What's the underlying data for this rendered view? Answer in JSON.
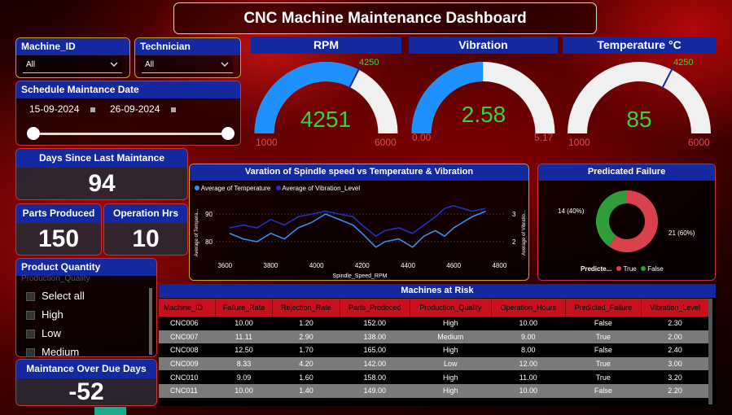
{
  "title": "CNC Machine Maintenance Dashboard",
  "colors": {
    "header_blue": "#1428a0",
    "accent_red": "#c8101e",
    "gauge_blue": "#1e90ff",
    "value_green": "#3ad23a"
  },
  "filters": {
    "machine_label": "Machine_ID",
    "machine_value": "All",
    "technician_label": "Technician",
    "technician_value": "All",
    "date_label": "Schedule Maintance Date",
    "date_from": "15-09-2024",
    "date_to": "26-09-2024"
  },
  "kpis": {
    "days_label": "Days Since Last Maintance",
    "days_value": "94",
    "parts_label": "Parts Produced",
    "parts_value": "150",
    "hours_label": "Operation Hrs",
    "hours_value": "10",
    "overdue_label": "Maintance Over Due Days",
    "overdue_value": "-52"
  },
  "product_quantity": {
    "label": "Product Quantity",
    "field_hint": "Production_Quality",
    "options": [
      "Select all",
      "High",
      "Low",
      "Medium"
    ]
  },
  "gauges": [
    {
      "title": "RPM",
      "value": "4251",
      "min": "1000",
      "max": "6000",
      "target": "4250",
      "fraction": 0.65,
      "target_fraction": 0.65
    },
    {
      "title": "Vibration",
      "value": "2.58",
      "min": "0.00",
      "max": "5.17",
      "target": "",
      "fraction": 0.499,
      "target_fraction": null
    },
    {
      "title": "Temperature °C",
      "value": "85",
      "min": "1000",
      "max": "6000",
      "target": "4250",
      "fraction": 0.0,
      "target_fraction": 0.65
    }
  ],
  "line_chart": {
    "title": "Varation of Spindle speed vs Temperature & Vibration",
    "legend": [
      "Average of Temperature",
      "Average of Vibration_Level"
    ],
    "xlabel": "Spindle_Speed_RPM",
    "ylabel_left": "Average of Tempera...",
    "ylabel_right": "Average of Vibratio...",
    "x_ticks": [
      "3600",
      "3800",
      "4000",
      "4200",
      "4400",
      "4600",
      "4800"
    ],
    "y_left_ticks": [
      "90",
      "80"
    ],
    "y_right_ticks": [
      "3",
      "2"
    ]
  },
  "chart_data": {
    "type": "line",
    "xlim": [
      3560,
      4820
    ],
    "ylim_left": [
      75,
      95
    ],
    "ylim_right": [
      1.5,
      3.5
    ],
    "series": [
      {
        "name": "Average of Temperature",
        "axis": "left",
        "x": [
          3620,
          3680,
          3740,
          3800,
          3860,
          3920,
          3980,
          4040,
          4100,
          4160,
          4200,
          4260,
          4300,
          4360,
          4420,
          4470,
          4520,
          4560,
          4600,
          4640,
          4680,
          4740
        ],
        "y": [
          83,
          81,
          80,
          83,
          81,
          85,
          87,
          90,
          88,
          86,
          83,
          78,
          80,
          81,
          78,
          82,
          84,
          82,
          85,
          87,
          89,
          91
        ]
      },
      {
        "name": "Average of Vibration_Level",
        "axis": "right",
        "x": [
          3620,
          3680,
          3740,
          3800,
          3860,
          3920,
          3980,
          4040,
          4100,
          4160,
          4200,
          4260,
          4300,
          4360,
          4420,
          4470,
          4520,
          4560,
          4600,
          4640,
          4680,
          4740
        ],
        "y": [
          2.5,
          2.6,
          2.5,
          2.8,
          2.6,
          2.9,
          3.0,
          3.1,
          3.0,
          2.9,
          2.6,
          2.2,
          2.4,
          2.5,
          2.3,
          2.6,
          2.9,
          3.2,
          3.3,
          3.2,
          3.1,
          3.2
        ]
      }
    ]
  },
  "donut": {
    "title": "Predicated Failure",
    "legend_title": "Predicte...",
    "label_left": "14 (40%)",
    "label_right": "21 (60%)",
    "slices": [
      {
        "name": "True",
        "value": 21,
        "color": "#d9414c"
      },
      {
        "name": "False",
        "value": 14,
        "color": "#2e9d3a"
      }
    ]
  },
  "table": {
    "title": "Machines at Risk",
    "columns": [
      "Machine_ID",
      "Failure_Rate",
      "Rejection_Rate",
      "Parts_Prodoced",
      "Production_Quality",
      "Operation_Hours",
      "Predicted_Failure",
      "Vibration_Level"
    ],
    "rows": [
      [
        "CNC006",
        "10.00",
        "1.20",
        "152.00",
        "High",
        "10.00",
        "False",
        "2.30"
      ],
      [
        "CNC007",
        "11.11",
        "2.90",
        "138.00",
        "Medium",
        "9.00",
        "True",
        "2.00"
      ],
      [
        "CNC008",
        "12.50",
        "1.70",
        "165.00",
        "High",
        "8.00",
        "False",
        "2.40"
      ],
      [
        "CNC009",
        "8.33",
        "4.20",
        "142.00",
        "Low",
        "12.00",
        "True",
        "3.00"
      ],
      [
        "CNC010",
        "9.09",
        "1.60",
        "158.00",
        "High",
        "11.00",
        "True",
        "3.20"
      ],
      [
        "CNC011",
        "10.00",
        "1.40",
        "149.00",
        "High",
        "10.00",
        "False",
        "2.20"
      ]
    ]
  }
}
